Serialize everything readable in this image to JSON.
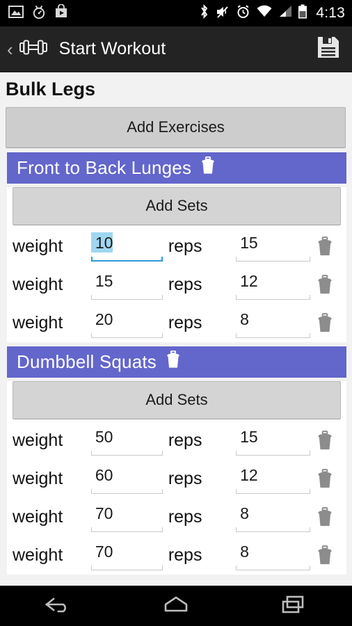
{
  "statusbar": {
    "time": "4:13",
    "left_icons": [
      "image-icon",
      "stopwatch-icon",
      "play-store-icon"
    ],
    "right_icons": [
      "bluetooth-icon",
      "volume-mute-icon",
      "alarm-icon",
      "wifi-icon",
      "cell-signal-icon",
      "battery-icon"
    ]
  },
  "actionbar": {
    "back_glyph": "‹",
    "app_icon": "dumbbell-icon",
    "title": "Start Workout",
    "save_icon": "save-floppy-icon"
  },
  "page": {
    "title": "Bulk Legs",
    "add_exercises_label": "Add Exercises"
  },
  "colors": {
    "section_header": "#6366cb",
    "focus_underline": "#2d9ad4",
    "selection_highlight": "#9fd6f0",
    "button_face": "#cdcdcd",
    "actionbar": "#232323",
    "statusbar": "#000000"
  },
  "labels": {
    "weight": "weight",
    "reps": "reps",
    "add_sets": "Add Sets",
    "delete_icon": "trash-icon"
  },
  "exercises": [
    {
      "name": "Front to Back Lunges",
      "add_sets_label": "Add Sets",
      "sets": [
        {
          "weight": "10",
          "reps": "15",
          "focused": true,
          "selected": true
        },
        {
          "weight": "15",
          "reps": "12",
          "focused": false,
          "selected": false
        },
        {
          "weight": "20",
          "reps": "8",
          "focused": false,
          "selected": false
        }
      ]
    },
    {
      "name": "Dumbbell Squats",
      "add_sets_label": "Add Sets",
      "sets": [
        {
          "weight": "50",
          "reps": "15",
          "focused": false,
          "selected": false
        },
        {
          "weight": "60",
          "reps": "12",
          "focused": false,
          "selected": false
        },
        {
          "weight": "70",
          "reps": "8",
          "focused": false,
          "selected": false
        },
        {
          "weight": "70",
          "reps": "8",
          "focused": false,
          "selected": false
        }
      ]
    }
  ],
  "navbar": {
    "back_label": "back-icon",
    "home_label": "home-icon",
    "recents_label": "recents-icon"
  }
}
